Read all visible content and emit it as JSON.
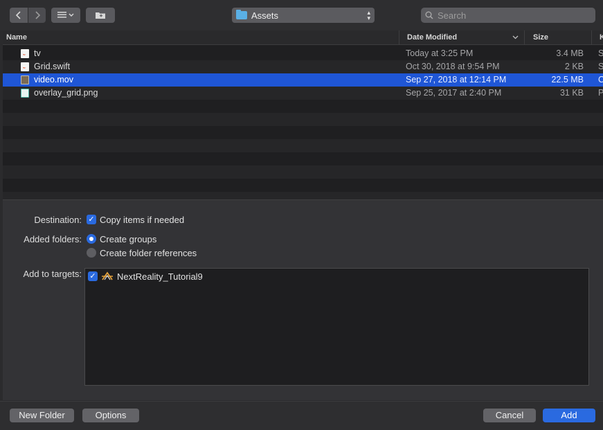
{
  "toolbar": {
    "back_icon": "chevron-left-icon",
    "forward_icon": "chevron-right-icon",
    "view_icon": "list-view-icon",
    "new_folder_icon": "new-folder-icon",
    "location": "Assets",
    "search_placeholder": "Search"
  },
  "list": {
    "columns": {
      "name": "Name",
      "date": "Date Modified",
      "size": "Size",
      "kind": "K"
    },
    "rows": [
      {
        "name": "tv",
        "date": "Today at 3:25 PM",
        "size": "3.4 MB",
        "kind": "S",
        "icon": "swift-file-icon"
      },
      {
        "name": "Grid.swift",
        "date": "Oct 30, 2018 at 9:54 PM",
        "size": "2 KB",
        "kind": "S",
        "icon": "swift-file-icon"
      },
      {
        "name": "video.mov",
        "date": "Sep 27, 2018 at 12:14 PM",
        "size": "22.5 MB",
        "kind": "C",
        "icon": "movie-file-icon"
      },
      {
        "name": "overlay_grid.png",
        "date": "Sep 25, 2017 at 2:40 PM",
        "size": "31 KB",
        "kind": "P",
        "icon": "image-file-icon"
      }
    ]
  },
  "options": {
    "destination_label": "Destination:",
    "copy_items_label": "Copy items if needed",
    "added_folders_label": "Added folders:",
    "create_groups_label": "Create groups",
    "create_refs_label": "Create folder references",
    "add_to_targets_label": "Add to targets:",
    "target_name": "NextReality_Tutorial9"
  },
  "buttons": {
    "new_folder": "New Folder",
    "options": "Options",
    "cancel": "Cancel",
    "add": "Add"
  },
  "colors": {
    "accent": "#2a6ae0",
    "selection": "#1f56d6"
  }
}
